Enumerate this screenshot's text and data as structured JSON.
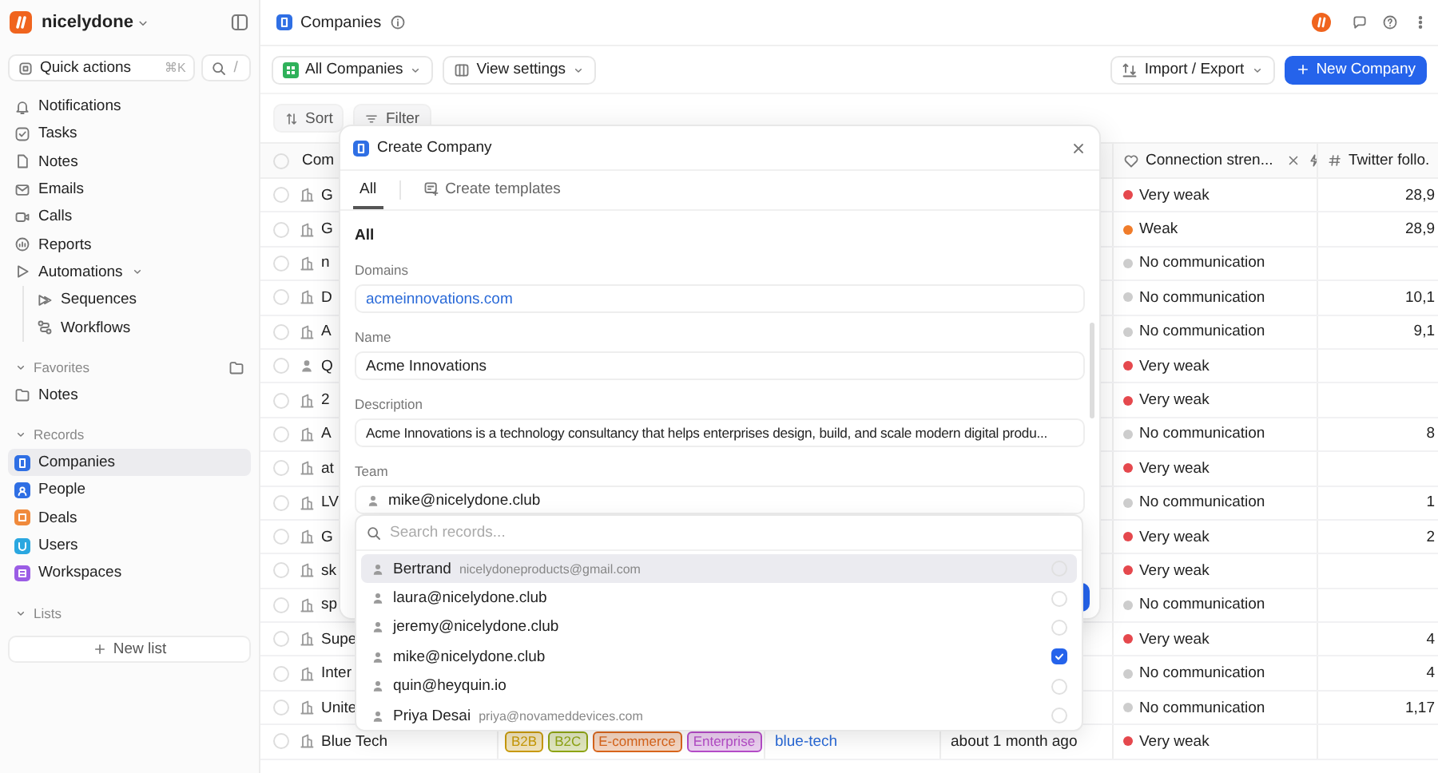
{
  "workspace": {
    "name": "nicelydone"
  },
  "quick_actions": {
    "label": "Quick actions",
    "shortcut": "⌘K",
    "search_shortcut": "/"
  },
  "nav": [
    {
      "label": "Notifications"
    },
    {
      "label": "Tasks"
    },
    {
      "label": "Notes"
    },
    {
      "label": "Emails"
    },
    {
      "label": "Calls"
    },
    {
      "label": "Reports"
    },
    {
      "label": "Automations",
      "expanded": true,
      "children": [
        {
          "label": "Sequences"
        },
        {
          "label": "Workflows"
        }
      ]
    }
  ],
  "favorites": {
    "title": "Favorites",
    "items": [
      {
        "label": "Notes"
      }
    ]
  },
  "records": {
    "title": "Records",
    "items": [
      {
        "label": "Companies",
        "selected": true,
        "color": "#2f6fe4"
      },
      {
        "label": "People",
        "selected": false,
        "color": "#2f6fe4"
      },
      {
        "label": "Deals",
        "selected": false,
        "color": "#f08a3c"
      },
      {
        "label": "Users",
        "selected": false,
        "color": "#2aa7e0"
      },
      {
        "label": "Workspaces",
        "selected": false,
        "color": "#9b5de5"
      }
    ]
  },
  "lists": {
    "title": "Lists",
    "new_button": "New list"
  },
  "page": {
    "title": "Companies"
  },
  "toolbar": {
    "view": "All Companies",
    "settings": "View settings",
    "import_export": "Import / Export",
    "new_button": "New Company",
    "sort": "Sort",
    "filter": "Filter"
  },
  "table": {
    "select_all_checked": false,
    "columns": [
      {
        "label": "Com"
      },
      {
        "label": "Connection stren..."
      },
      {
        "label": "Twitter follo."
      }
    ],
    "rows": [
      {
        "checked": false,
        "name": "G",
        "kind": "company",
        "connection": {
          "label": "Very weak",
          "color": "#e5484d"
        },
        "twitter": "28,9"
      },
      {
        "checked": false,
        "name": "G",
        "kind": "company",
        "connection": {
          "label": "Weak",
          "color": "#f07c2a"
        },
        "twitter": "28,9"
      },
      {
        "checked": false,
        "name": "n",
        "kind": "company",
        "connection": {
          "label": "No communication",
          "color": "#cdcdcd"
        }
      },
      {
        "checked": false,
        "name": "D",
        "kind": "company",
        "connection": {
          "label": "No communication",
          "color": "#cdcdcd"
        },
        "twitter": "10,1"
      },
      {
        "checked": false,
        "name": "A",
        "kind": "company",
        "connection": {
          "label": "No communication",
          "color": "#cdcdcd"
        },
        "twitter": "9,1"
      },
      {
        "checked": false,
        "name": "Q",
        "kind": "person",
        "connection": {
          "label": "Very weak",
          "color": "#e5484d"
        }
      },
      {
        "checked": false,
        "name": "2",
        "kind": "company",
        "connection": {
          "label": "Very weak",
          "color": "#e5484d"
        }
      },
      {
        "checked": false,
        "name": "A",
        "kind": "company",
        "connection": {
          "label": "No communication",
          "color": "#cdcdcd"
        },
        "twitter": "8"
      },
      {
        "checked": false,
        "name": "at",
        "kind": "company",
        "connection": {
          "label": "Very weak",
          "color": "#e5484d"
        }
      },
      {
        "checked": false,
        "name": "LV",
        "kind": "company",
        "connection": {
          "label": "No communication",
          "color": "#cdcdcd"
        },
        "twitter": "1"
      },
      {
        "checked": false,
        "name": "G",
        "kind": "company",
        "connection": {
          "label": "Very weak",
          "color": "#e5484d"
        },
        "twitter": "2"
      },
      {
        "checked": false,
        "name": "sk",
        "kind": "company",
        "connection": {
          "label": "Very weak",
          "color": "#e5484d"
        }
      },
      {
        "checked": false,
        "name": "sp",
        "kind": "company",
        "connection": {
          "label": "No communication",
          "color": "#cdcdcd"
        }
      },
      {
        "checked": false,
        "name": "Supe",
        "kind": "company",
        "connection": {
          "label": "Very weak",
          "color": "#e5484d"
        },
        "twitter": "4"
      },
      {
        "checked": false,
        "name": "Inter",
        "kind": "company",
        "connection": {
          "label": "No communication",
          "color": "#cdcdcd"
        },
        "twitter": "4"
      },
      {
        "checked": false,
        "name": "Unite",
        "kind": "company",
        "connection": {
          "label": "No communication",
          "color": "#cdcdcd"
        },
        "twitter": "1,17"
      },
      {
        "checked": false,
        "name": "Blue Tech",
        "kind": "company",
        "tags": [
          {
            "label": "B2B",
            "color": "#c99a06"
          },
          {
            "label": "B2C",
            "color": "#8fa514"
          },
          {
            "label": "E-commerce",
            "color": "#d9651c"
          },
          {
            "label": "Enterprise",
            "color": "#b54cc8"
          }
        ],
        "domain": "blue-tech",
        "last_interaction": "about 1 month ago",
        "connection": {
          "label": "Very weak",
          "color": "#e5484d"
        }
      }
    ]
  },
  "modal": {
    "title": "Create Company",
    "tabs": [
      {
        "label": "All",
        "selected": true
      },
      {
        "label": "Create templates",
        "selected": false
      }
    ],
    "section": "All",
    "fields": [
      {
        "label": "Domains",
        "value": "acmeinnovations.com",
        "kind": "link"
      },
      {
        "label": "Name",
        "value": "Acme Innovations",
        "kind": "text"
      },
      {
        "label": "Description",
        "value": "Acme Innovations is a technology consultancy that helps enterprises design, build, and scale modern digital produ...",
        "kind": "text"
      },
      {
        "label": "Team",
        "value": "mike@nicelydone.club",
        "kind": "person"
      }
    ],
    "dropdown": {
      "placeholder": "Search records...",
      "options": [
        {
          "name": "Bertrand",
          "email": "nicelydoneproducts@gmail.com",
          "checked": false,
          "hovered": true
        },
        {
          "name": "laura@nicelydone.club",
          "checked": false,
          "hovered": false
        },
        {
          "name": "jeremy@nicelydone.club",
          "checked": false,
          "hovered": false
        },
        {
          "name": "mike@nicelydone.club",
          "checked": true,
          "hovered": false
        },
        {
          "name": "quin@heyquin.io",
          "checked": false,
          "hovered": false
        },
        {
          "name": "Priya Desai",
          "email": "priya@novameddevices.com",
          "checked": false,
          "hovered": false
        }
      ]
    }
  }
}
